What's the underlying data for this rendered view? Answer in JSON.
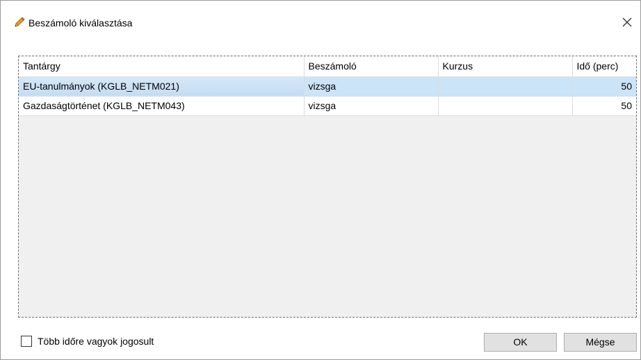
{
  "window": {
    "title": "Beszámoló kiválasztása",
    "close_symbol": "✕"
  },
  "table": {
    "columns": [
      "Tantárgy",
      "Beszámoló",
      "Kurzus",
      "Idő (perc)"
    ],
    "rows": [
      {
        "subject": "EU-tanulmányok (KGLB_NETM021)",
        "assessment": "vizsga",
        "course": "",
        "time": "50",
        "selected": true
      },
      {
        "subject": "Gazdaságtörténet (KGLB_NETM043)",
        "assessment": "vizsga",
        "course": "",
        "time": "50",
        "selected": false
      }
    ]
  },
  "footer": {
    "checkbox_label": "Több időre vagyok jogosult",
    "checkbox_checked": false,
    "ok_label": "OK",
    "cancel_label": "Mégse"
  },
  "colors": {
    "selection": "#cce4f7",
    "grid_background": "#f0f0f0",
    "button_face": "#e1e1e1"
  },
  "icons": {
    "title_icon": "pencil-icon",
    "close_icon": "close-icon"
  }
}
